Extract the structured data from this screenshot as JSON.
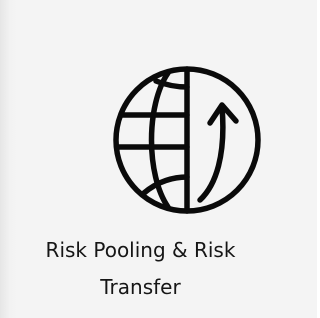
{
  "card": {
    "icon": "globe-arrow-icon",
    "title_line1": "Risk Pooling & Risk",
    "title_line2": "Transfer"
  },
  "colors": {
    "background": "#f4f4f4",
    "icon": "#0a0a0a",
    "text": "#161616"
  }
}
